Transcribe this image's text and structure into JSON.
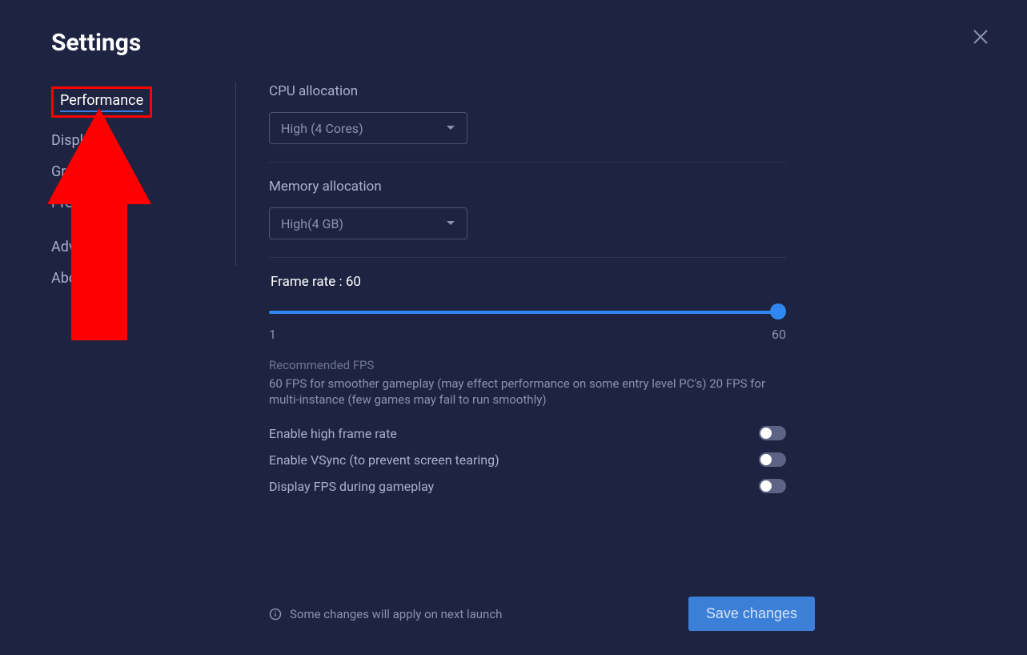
{
  "title": "Settings",
  "sidebar": {
    "items": [
      {
        "label": "Performance",
        "active": true
      },
      {
        "label": "Display"
      },
      {
        "label": "Graphics"
      },
      {
        "label": "Preferences"
      },
      {
        "label": "Advanced"
      },
      {
        "label": "About"
      }
    ]
  },
  "content": {
    "cpu": {
      "label": "CPU allocation",
      "value": "High (4 Cores)"
    },
    "memory": {
      "label": "Memory allocation",
      "value": "High(4 GB)"
    },
    "frameRate": {
      "labelPrefix": "Frame rate : ",
      "value": "60",
      "min": "1",
      "max": "60"
    },
    "hint": {
      "title": "Recommended FPS",
      "text": "60 FPS for smoother gameplay (may effect performance on some entry level PC's) 20 FPS for multi-instance (few games may fail to run smoothly)"
    },
    "toggles": [
      {
        "label": "Enable high frame rate",
        "on": false
      },
      {
        "label": "Enable VSync (to prevent screen tearing)",
        "on": false
      },
      {
        "label": "Display FPS during gameplay",
        "on": false
      }
    ]
  },
  "footer": {
    "note": "Some changes will apply on next launch",
    "saveLabel": "Save changes"
  }
}
